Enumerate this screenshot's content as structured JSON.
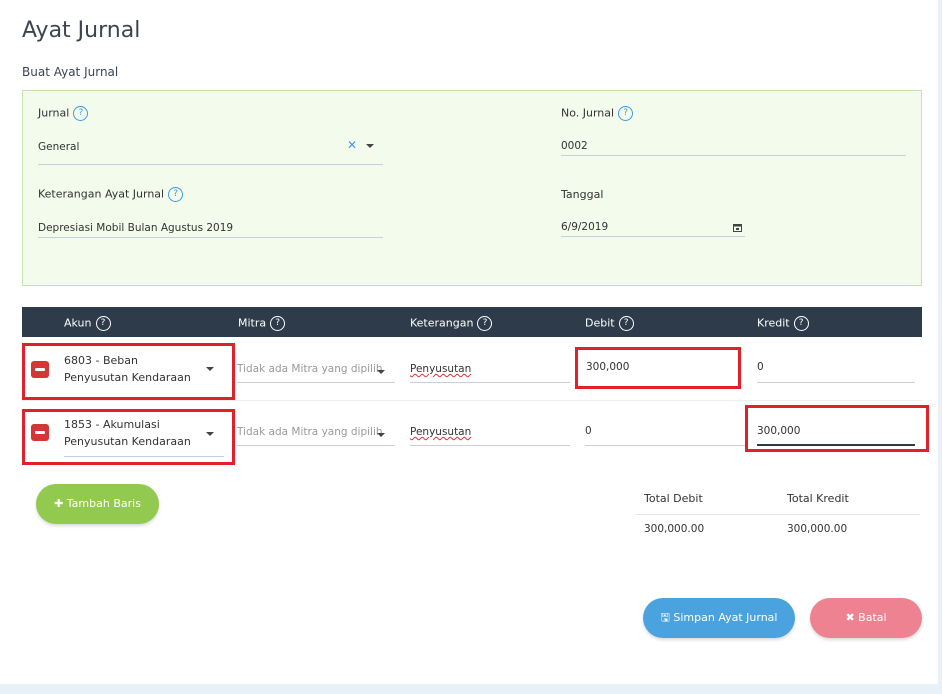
{
  "page": {
    "title": "Ayat Jurnal",
    "subtitle": "Buat Ayat Jurnal"
  },
  "form": {
    "jurnal_label": "Jurnal",
    "jurnal_value": "General",
    "no_jurnal_label": "No. Jurnal",
    "no_jurnal_value": "0002",
    "keterangan_label": "Keterangan Ayat Jurnal",
    "keterangan_value": "Depresiasi Mobil Bulan Agustus 2019",
    "tanggal_label": "Tanggal",
    "tanggal_value": "6/9/2019",
    "help_glyph": "?",
    "clear_glyph": "✕"
  },
  "table": {
    "headers": {
      "akun": "Akun",
      "mitra": "Mitra",
      "keterangan": "Keterangan",
      "debit": "Debit",
      "kredit": "Kredit"
    },
    "rows": [
      {
        "akun": "6803 - Beban Penyusutan Kendaraan",
        "mitra_placeholder": "Tidak ada Mitra yang dipilih",
        "keterangan": "Penyusutan",
        "debit": "300,000",
        "kredit": "0"
      },
      {
        "akun": "1853 - Akumulasi Penyusutan Kendaraan",
        "mitra_placeholder": "Tidak ada Mitra yang dipilih",
        "keterangan": "Penyusutan",
        "debit": "0",
        "kredit": "300,000"
      }
    ]
  },
  "actions": {
    "add_row": "✚ Tambah Baris",
    "save": "🖫 Simpan Ayat Jurnal",
    "cancel": "✖ Batal"
  },
  "totals": {
    "debit_label": "Total Debit",
    "kredit_label": "Total Kredit",
    "debit_value": "300,000.00",
    "kredit_value": "300,000.00"
  },
  "colors": {
    "header_bg": "#2e3b4a",
    "panel_bg": "#f3fbec",
    "add_button": "#92c94f",
    "save_button": "#4aa3de",
    "cancel_button": "#ee8290",
    "highlight": "#e0202a",
    "delete_button": "#d23636"
  }
}
